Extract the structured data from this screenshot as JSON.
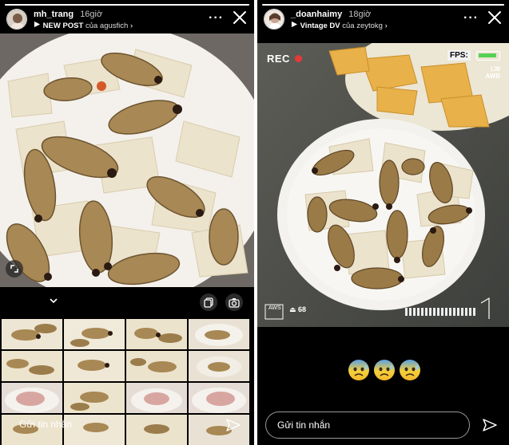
{
  "left_story": {
    "username": "mh_trang",
    "time": "16giờ",
    "post_title": "NEW POST",
    "post_by": "của agusfich",
    "more_label": "···",
    "reply_placeholder": "Gửi tin nhắn",
    "progress": 1.0
  },
  "right_story": {
    "username": "_doanhaimy",
    "time": "18giờ",
    "music_title": "Vintage DV",
    "music_by": "của zeytokg",
    "more_label": "···",
    "rec_label": "REC",
    "fps_label": "FPS:",
    "awb_label": "LW AWB",
    "aws_label": "AWS",
    "level_label": "68",
    "reply_placeholder": "Gửi tin nhắn",
    "emojis": [
      "cold-sweat-emoji",
      "cold-sweat-emoji",
      "cold-sweat-emoji"
    ],
    "progress": 1.0
  },
  "colors": {
    "rec_red": "#e53935",
    "battery_green": "#55d155",
    "background": "#000000"
  }
}
